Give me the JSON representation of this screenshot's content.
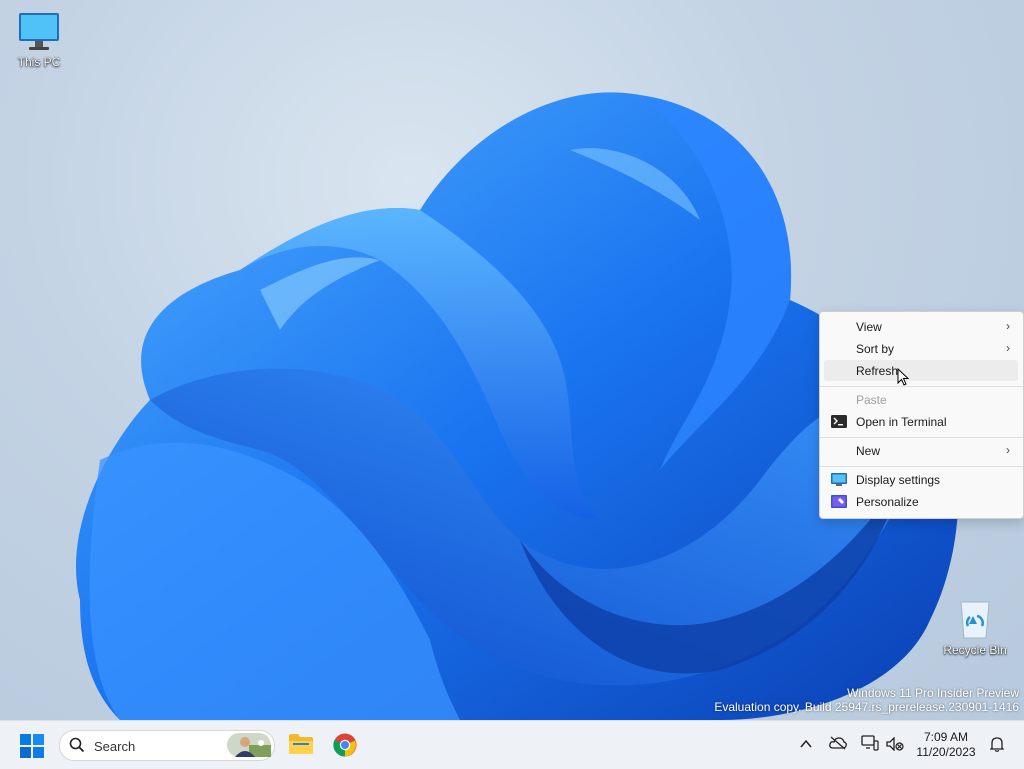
{
  "desktop": {
    "icons": [
      {
        "label": "This PC",
        "icon": "monitor-icon"
      },
      {
        "label": "Recycle Bin",
        "icon": "recycle-bin-icon"
      }
    ],
    "watermark": {
      "line1": "Windows 11 Pro Insider Preview",
      "line2": "Evaluation copy. Build 25947.rs_prerelease.230901-1416"
    }
  },
  "context_menu": {
    "items": [
      {
        "label": "View",
        "submenu": true
      },
      {
        "label": "Sort by",
        "submenu": true
      },
      {
        "label": "Refresh",
        "hovered": true
      },
      {
        "label": "Paste",
        "disabled": true
      },
      {
        "label": "Open in Terminal",
        "icon": "terminal-icon"
      },
      {
        "label": "New",
        "submenu": true
      },
      {
        "label": "Display settings",
        "icon": "display-icon"
      },
      {
        "label": "Personalize",
        "icon": "personalize-icon"
      }
    ]
  },
  "taskbar": {
    "start_icon": "windows-logo-icon",
    "search": {
      "placeholder": "Search"
    },
    "pinned": [
      "file-explorer-icon",
      "chrome-icon"
    ],
    "tray": [
      "chevron-up-icon",
      "onedrive-offline-icon",
      "network-icon",
      "volume-muted-icon"
    ],
    "clock": {
      "time": "7:09 AM",
      "date": "11/20/2023"
    },
    "notification_icon": "bell-icon"
  },
  "colors": {
    "accent": "#0067c0",
    "bloom_dark": "#0a3fb3",
    "bloom_light": "#3fa0ff",
    "taskbar_bg": "#eef1f6"
  }
}
